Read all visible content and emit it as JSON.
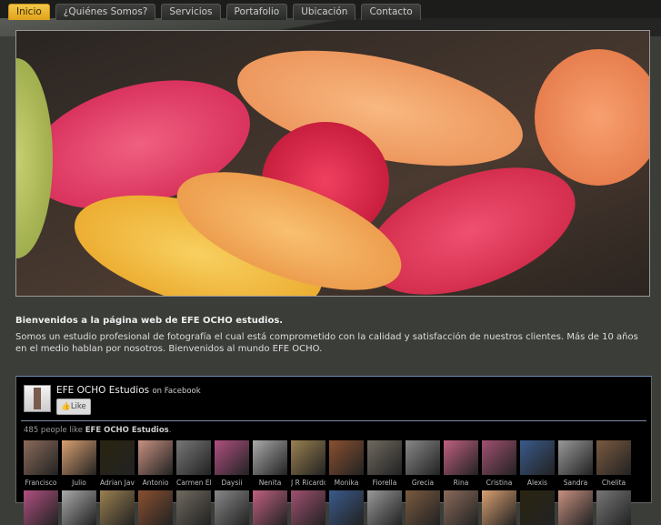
{
  "nav": {
    "tabs": [
      "Inicio",
      "¿Quiénes Somos?",
      "Servicios",
      "Portafolio",
      "Ubicación",
      "Contacto"
    ],
    "active": "Inicio"
  },
  "content": {
    "heading": "Bienvenidos a la página web de EFE OCHO estudios.",
    "paragraph": "Somos un estudio profesional de fotografía el cual está comprometido con la calidad y satisfacción de nuestros clientes. Más de 10 años en el medio hablan por nosotros. Bienvenidos al mundo EFE OCHO."
  },
  "facebook": {
    "page_name": "EFE OCHO Estudios",
    "on_facebook": "on Facebook",
    "like_label": "Like",
    "count_prefix": "485 people like",
    "count_page": "EFE OCHO Estudios",
    "count_suffix": ".",
    "fans": [
      "Francisco",
      "Julio",
      "Adrian Javi",
      "Antonio",
      "Carmen El",
      "Daysii",
      "Nenita",
      "J R Ricardo",
      "Monika",
      "Fiorella",
      "Grecia",
      "Rina",
      "Cristina",
      "Alexis",
      "Sandra",
      "Chelita"
    ],
    "fan_colors": [
      "#8a6a5a",
      "#d9a070",
      "#2a2410",
      "#c79080",
      "#777",
      "#b05080",
      "#aaa",
      "#9a8050",
      "#8a5030",
      "#706a60",
      "#888",
      "#c06080",
      "#a05070",
      "#3a5a8a",
      "#999",
      "#7a5a40"
    ]
  },
  "accent": "#e8b030"
}
